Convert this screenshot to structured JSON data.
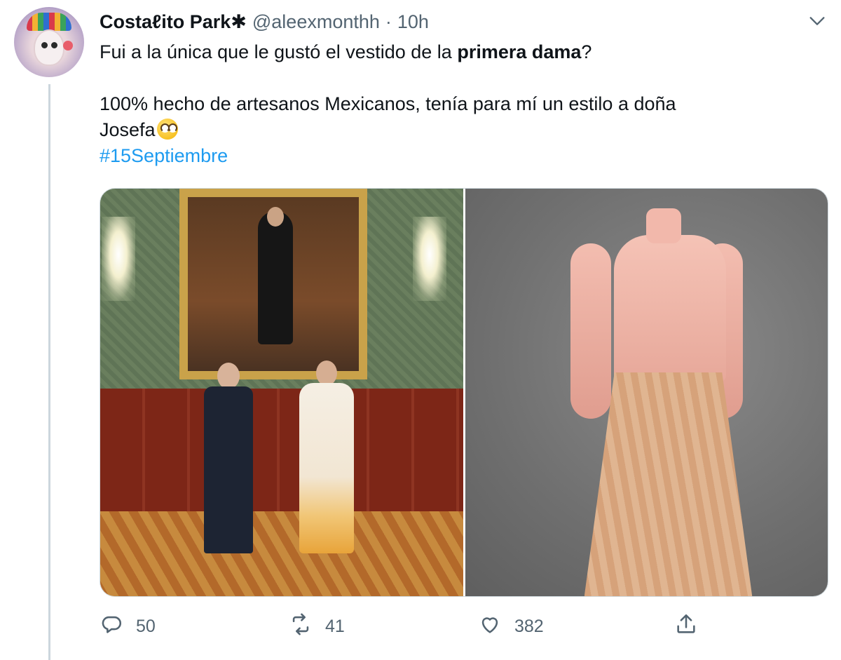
{
  "tweet": {
    "display_name": "Costaℓito Park✱",
    "handle": "@aleexmonthh",
    "separator": "·",
    "time": "10h",
    "text": {
      "line1_before": "Fui a la única que le gustó el vestido de la ",
      "line1_bold": "primera dama",
      "line1_after": "?",
      "line2": "100% hecho de artesanos Mexicanos, tenía para mí un estilo a doña",
      "line3": "Josefa",
      "hashtag": "#15Septiembre"
    },
    "icons": {
      "more": "chevron-down-icon",
      "emoji": "face-with-rolling-eyes-emoji",
      "reply": "reply-icon",
      "retweet": "retweet-icon",
      "like": "heart-icon",
      "share": "share-icon"
    },
    "stats": {
      "replies": "50",
      "retweets": "41",
      "likes": "382"
    }
  },
  "colors": {
    "text": "#0f1419",
    "secondary": "#536471",
    "link": "#1d9bf0",
    "thread_line": "#ccd6dd"
  }
}
